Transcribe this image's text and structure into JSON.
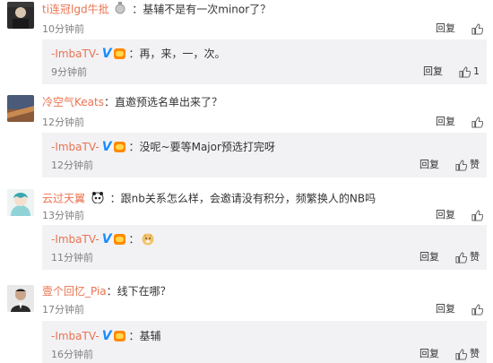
{
  "labels": {
    "reply": "回复",
    "like": "赞"
  },
  "comments": [
    {
      "user": "ti连冠lgd牛批",
      "text": "：基辅不是有一次minor了？",
      "time": "10分钟前",
      "reply": {
        "user": "-ImbaTV-",
        "text": "：再，来，一，次。",
        "time": "9分钟前",
        "like_count": "1"
      }
    },
    {
      "user": "冷空气Keats",
      "text": "：直邀预选名单出来了？",
      "time": "12分钟前",
      "reply": {
        "user": "-ImbaTV-",
        "text": "：没呢~要等Major预选打完呀",
        "time": "12分钟前",
        "like_count": ""
      }
    },
    {
      "user": "云过天翼",
      "text": "：跟nb关系怎么样，会邀请没有积分，频繁换人的NB吗",
      "time": "13分钟前",
      "reply": {
        "user": "-ImbaTV-",
        "text": "：",
        "time": "11分钟前",
        "like_count": ""
      }
    },
    {
      "user": "壹个回忆_Pia",
      "text": "：线下在哪？",
      "time": "17分钟前",
      "reply": {
        "user": "-ImbaTV-",
        "text": "：基辅",
        "time": "16分钟前",
        "like_count": ""
      }
    }
  ],
  "colors": {
    "username": "#eb7350",
    "verified": "#1a8cff",
    "reply_bg": "#f2f2f5",
    "time": "#808080"
  }
}
